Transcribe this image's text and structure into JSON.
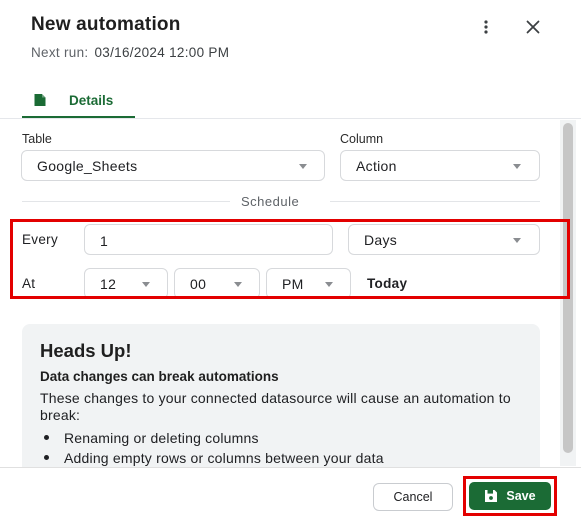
{
  "header": {
    "title": "New automation",
    "next_run_label": "Next run:",
    "next_run_value": "03/16/2024 12:00 PM",
    "more_icon": "more-vertical-icon",
    "close_icon": "close-icon"
  },
  "tabs": [
    {
      "label": "Details",
      "icon": "document-icon",
      "active": true
    }
  ],
  "form": {
    "table_label": "Table",
    "table_value": "Google_Sheets",
    "column_label": "Column",
    "column_value": "Action",
    "schedule_heading": "Schedule",
    "every_label": "Every",
    "every_value": "1",
    "every_unit": "Days",
    "at_label": "At",
    "at_hour": "12",
    "at_minute": "00",
    "at_period": "PM",
    "at_day": "Today"
  },
  "notice": {
    "title": "Heads Up!",
    "subtitle": "Data changes can break automations",
    "body": "These changes to your connected datasource will cause an automation to break:",
    "bullets": [
      "Renaming or deleting columns",
      "Adding empty rows or columns between your data"
    ]
  },
  "footer": {
    "cancel_label": "Cancel",
    "save_label": "Save",
    "save_icon": "floppy-disk-icon"
  },
  "colors": {
    "accent": "#1b6b35",
    "highlight": "#e30000"
  }
}
